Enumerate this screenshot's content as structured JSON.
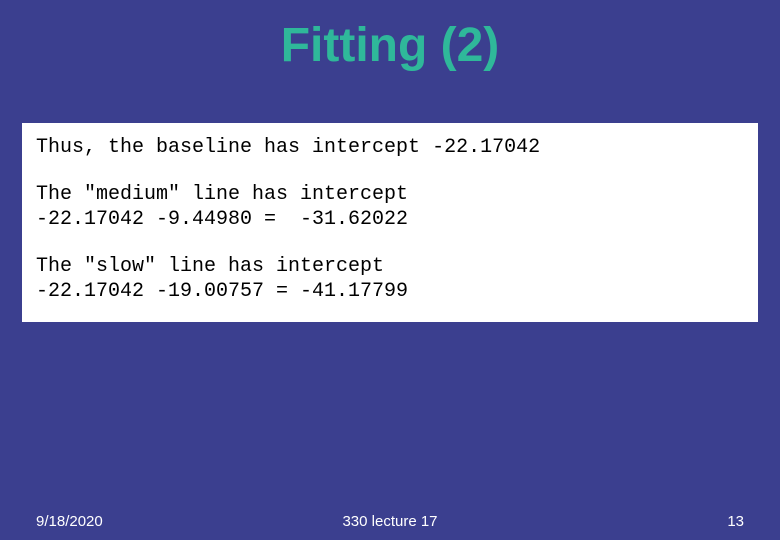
{
  "title": "Fitting (2)",
  "content": {
    "p1": "Thus, the baseline has intercept -22.17042",
    "p2": "The \"medium\" line has intercept\n-22.17042 -9.44980 =  -31.62022",
    "p3": "The \"slow\" line has intercept\n-22.17042 -19.00757 = -41.17799"
  },
  "footer": {
    "date": "9/18/2020",
    "center": "330 lecture 17",
    "page": "13"
  }
}
